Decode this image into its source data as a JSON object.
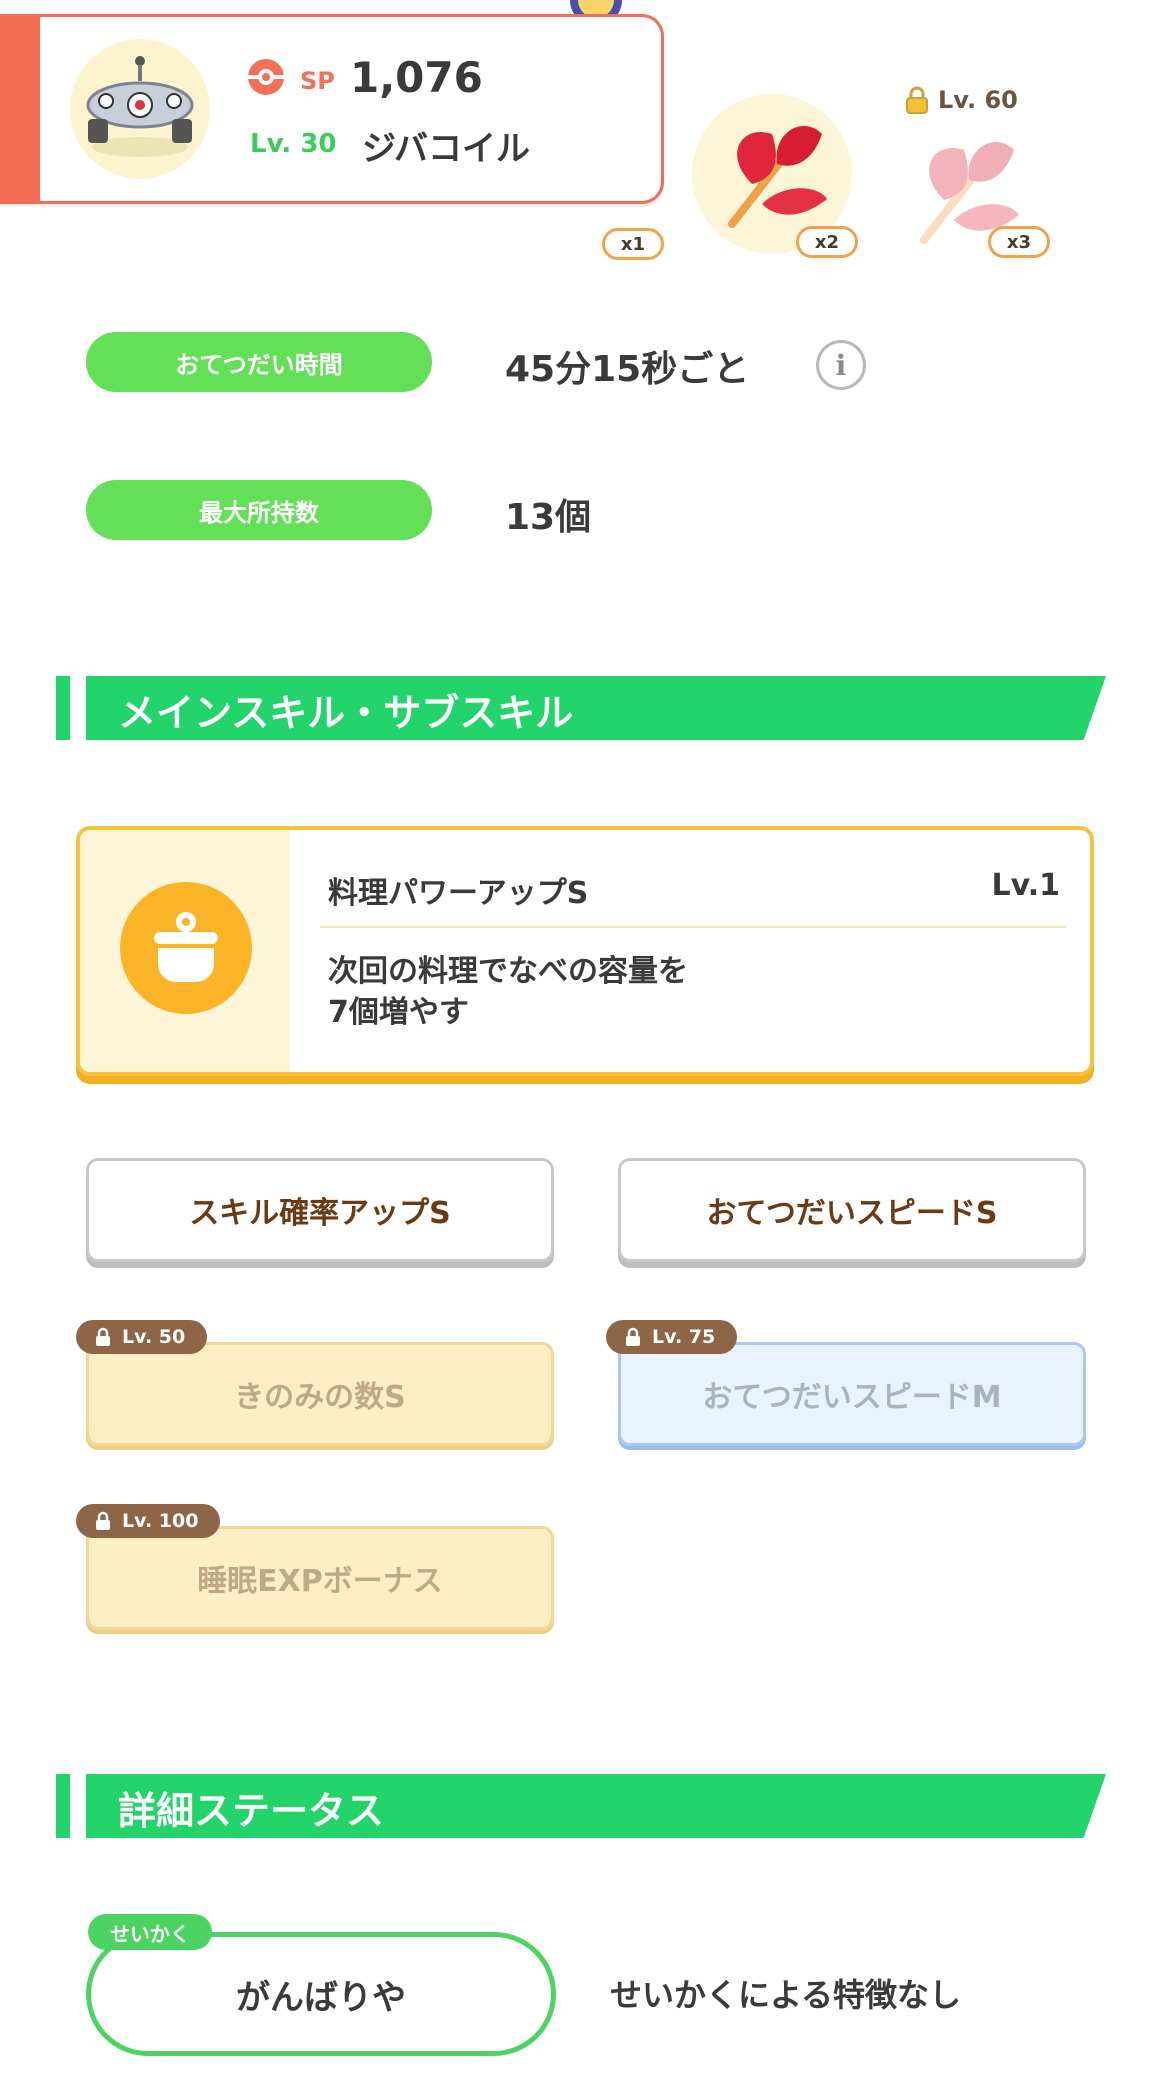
{
  "pokemon": {
    "sp_label": "SP",
    "sp_value": "1,076",
    "level": "Lv. 30",
    "name": "ジバコイル"
  },
  "ingredients": [
    {
      "count": "x1",
      "locked": false,
      "lock_level": ""
    },
    {
      "count": "x2",
      "locked": false,
      "lock_level": ""
    },
    {
      "count": "x3",
      "locked": true,
      "lock_level": "Lv. 60"
    }
  ],
  "info": {
    "help_time_label": "おてつだい時間",
    "help_time_value": "45分15秒ごと",
    "info_icon_glyph": "i",
    "max_carry_label": "最大所持数",
    "max_carry_value": "13個"
  },
  "skills_section": {
    "title": "メインスキル・サブスキル",
    "main_skill": {
      "name": "料理パワーアップS",
      "level": "Lv.1",
      "description": "次回の料理でなべの容量を\n7個増やす",
      "icon": "cooking-pot-icon"
    },
    "sub_skills": [
      {
        "label": "スキル確率アップS",
        "state": "active",
        "lock_level": ""
      },
      {
        "label": "おてつだいスピードS",
        "state": "active",
        "lock_level": ""
      },
      {
        "label": "きのみの数S",
        "state": "locked",
        "lock_level": "Lv. 50"
      },
      {
        "label": "おてつだいスピードM",
        "state": "locked",
        "lock_level": "Lv. 75"
      },
      {
        "label": "睡眠EXPボーナス",
        "state": "locked",
        "lock_level": "Lv. 100"
      }
    ]
  },
  "detail_section": {
    "title": "詳細ステータス",
    "nature_tag": "せいかく",
    "nature_value": "がんばりや",
    "nature_desc": "せいかくによる特徴なし"
  },
  "colors": {
    "accent_green": "#23d46b",
    "pill_green": "#63df58",
    "card_red": "#f26e5b",
    "skill_gold": "#f7c23b",
    "sub_text_brown": "#6b3a12",
    "lock_tag_brown": "#8f6547"
  }
}
